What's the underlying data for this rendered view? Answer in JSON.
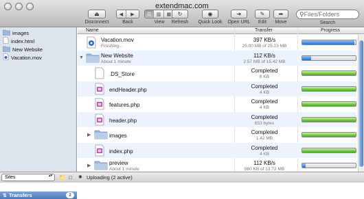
{
  "window": {
    "title": "extendmac.com"
  },
  "toolbar": {
    "disconnect": "Disconnect",
    "back": "Back",
    "view": "View",
    "refresh": "Refresh",
    "quicklook": "Quick Look",
    "openurl": "Open URL",
    "edit": "Edit",
    "move": "Move",
    "search_placeholder": "Files/Folders",
    "search_label": "Search"
  },
  "sidebar": {
    "items": [
      {
        "label": "images",
        "icon": "folder-icon"
      },
      {
        "label": "index.html",
        "icon": "file-icon"
      },
      {
        "label": "New Website",
        "icon": "folder-icon"
      },
      {
        "label": "Vacation.mov",
        "icon": "movie-file-icon"
      }
    ],
    "transfers_label": "Transfers",
    "transfers_count": "2"
  },
  "columns": {
    "name": "Name",
    "transfer": "Transfer",
    "progress": "Progress"
  },
  "rows": [
    {
      "name": "Vacation.mov",
      "sub": "Finishing...",
      "rate": "397 KB/s",
      "size": "25.00 MB of 25.23 MB",
      "progress": 0.98,
      "color": "blue",
      "icon": "movie-file-icon",
      "indent": 0,
      "disclosure": false
    },
    {
      "name": "New Website",
      "sub": "About 1 minute",
      "rate": "112 KB/s",
      "size": "2.57 MB of 15.42 MB",
      "progress": 0.17,
      "color": "blue",
      "icon": "folder-icon",
      "indent": 0,
      "disclosure": "open"
    },
    {
      "name": ".DS_Store",
      "sub": "",
      "rate": "Completed",
      "size": "6 KB",
      "progress": 1.0,
      "color": "green",
      "icon": "blank-file-icon",
      "indent": 1,
      "disclosure": false
    },
    {
      "name": "endHeader.php",
      "sub": "",
      "rate": "Completed",
      "size": "4 KB",
      "progress": 1.0,
      "color": "green",
      "icon": "php-file-icon",
      "indent": 1,
      "disclosure": false
    },
    {
      "name": "features.php",
      "sub": "",
      "rate": "Completed",
      "size": "4 KB",
      "progress": 1.0,
      "color": "green",
      "icon": "php-file-icon",
      "indent": 1,
      "disclosure": false
    },
    {
      "name": "header.php",
      "sub": "",
      "rate": "Completed",
      "size": "653 bytes",
      "progress": 1.0,
      "color": "green",
      "icon": "php-file-icon",
      "indent": 1,
      "disclosure": false
    },
    {
      "name": "images",
      "sub": "",
      "rate": "Completed",
      "size": "1.42 MB",
      "progress": 1.0,
      "color": "green",
      "icon": "folder-icon",
      "indent": 1,
      "disclosure": "closed"
    },
    {
      "name": "index.php",
      "sub": "",
      "rate": "Completed",
      "size": "4 KB",
      "progress": 1.0,
      "color": "green",
      "icon": "php-file-icon",
      "indent": 1,
      "disclosure": false
    },
    {
      "name": "preview",
      "sub": "About 1 minute",
      "rate": "112 KB/s",
      "size": "960 KB of 13.72 MB",
      "progress": 0.07,
      "color": "blue",
      "icon": "folder-icon",
      "indent": 1,
      "disclosure": "closed"
    }
  ],
  "bottombar": {
    "sites_label": "Sites",
    "status": "Uploading (2 active)"
  },
  "colors": {
    "progress_blue": "#1c6fe0",
    "progress_green": "#3fae0e",
    "sidebar_bg": "#dde4ec",
    "alt_row": "#edf3fe"
  }
}
